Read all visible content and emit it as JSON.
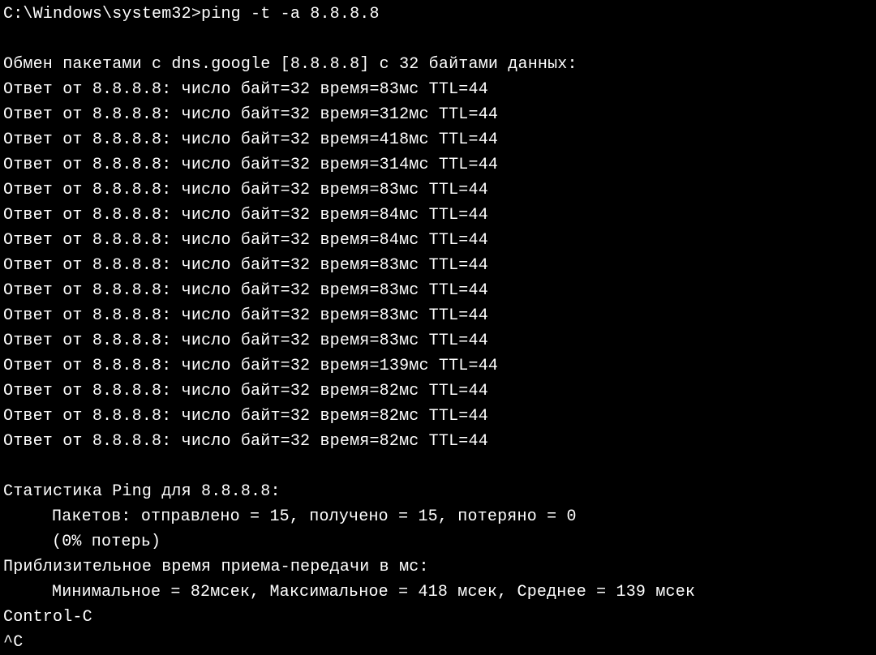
{
  "prompt": "C:\\Windows\\system32>",
  "command": "ping -t -a 8.8.8.8",
  "host": "dns.google",
  "ip": "8.8.8.8",
  "bytes": 32,
  "header_line": "Обмен пакетами с dns.google [8.8.8.8] с 32 байтами данных:",
  "replies": [
    {
      "bytes": 32,
      "time": 83,
      "ttl": 44
    },
    {
      "bytes": 32,
      "time": 312,
      "ttl": 44
    },
    {
      "bytes": 32,
      "time": 418,
      "ttl": 44
    },
    {
      "bytes": 32,
      "time": 314,
      "ttl": 44
    },
    {
      "bytes": 32,
      "time": 83,
      "ttl": 44
    },
    {
      "bytes": 32,
      "time": 84,
      "ttl": 44
    },
    {
      "bytes": 32,
      "time": 84,
      "ttl": 44
    },
    {
      "bytes": 32,
      "time": 83,
      "ttl": 44
    },
    {
      "bytes": 32,
      "time": 83,
      "ttl": 44
    },
    {
      "bytes": 32,
      "time": 83,
      "ttl": 44
    },
    {
      "bytes": 32,
      "time": 83,
      "ttl": 44
    },
    {
      "bytes": 32,
      "time": 139,
      "ttl": 44
    },
    {
      "bytes": 32,
      "time": 82,
      "ttl": 44
    },
    {
      "bytes": 32,
      "time": 82,
      "ttl": 44
    },
    {
      "bytes": 32,
      "time": 82,
      "ttl": 44
    }
  ],
  "reply_lines": [
    "Ответ от 8.8.8.8: число байт=32 время=83мс TTL=44",
    "Ответ от 8.8.8.8: число байт=32 время=312мс TTL=44",
    "Ответ от 8.8.8.8: число байт=32 время=418мс TTL=44",
    "Ответ от 8.8.8.8: число байт=32 время=314мс TTL=44",
    "Ответ от 8.8.8.8: число байт=32 время=83мс TTL=44",
    "Ответ от 8.8.8.8: число байт=32 время=84мс TTL=44",
    "Ответ от 8.8.8.8: число байт=32 время=84мс TTL=44",
    "Ответ от 8.8.8.8: число байт=32 время=83мс TTL=44",
    "Ответ от 8.8.8.8: число байт=32 время=83мс TTL=44",
    "Ответ от 8.8.8.8: число байт=32 время=83мс TTL=44",
    "Ответ от 8.8.8.8: число байт=32 время=83мс TTL=44",
    "Ответ от 8.8.8.8: число байт=32 время=139мс TTL=44",
    "Ответ от 8.8.8.8: число байт=32 время=82мс TTL=44",
    "Ответ от 8.8.8.8: число байт=32 время=82мс TTL=44",
    "Ответ от 8.8.8.8: число байт=32 время=82мс TTL=44"
  ],
  "stats": {
    "title": "Статистика Ping для 8.8.8.8:",
    "packets_line": "Пакетов: отправлено = 15, получено = 15, потеряно = 0",
    "loss_line": "(0% потерь)",
    "sent": 15,
    "received": 15,
    "lost": 0,
    "loss_pct": 0,
    "rtt_title": "Приблизительное время приема-передачи в мс:",
    "rtt_line": "Минимальное = 82мсек, Максимальное = 418 мсек, Среднее = 139 мсек",
    "min_ms": 82,
    "max_ms": 418,
    "avg_ms": 139
  },
  "interrupt": "Control-C",
  "interrupt_symbol": "^C"
}
